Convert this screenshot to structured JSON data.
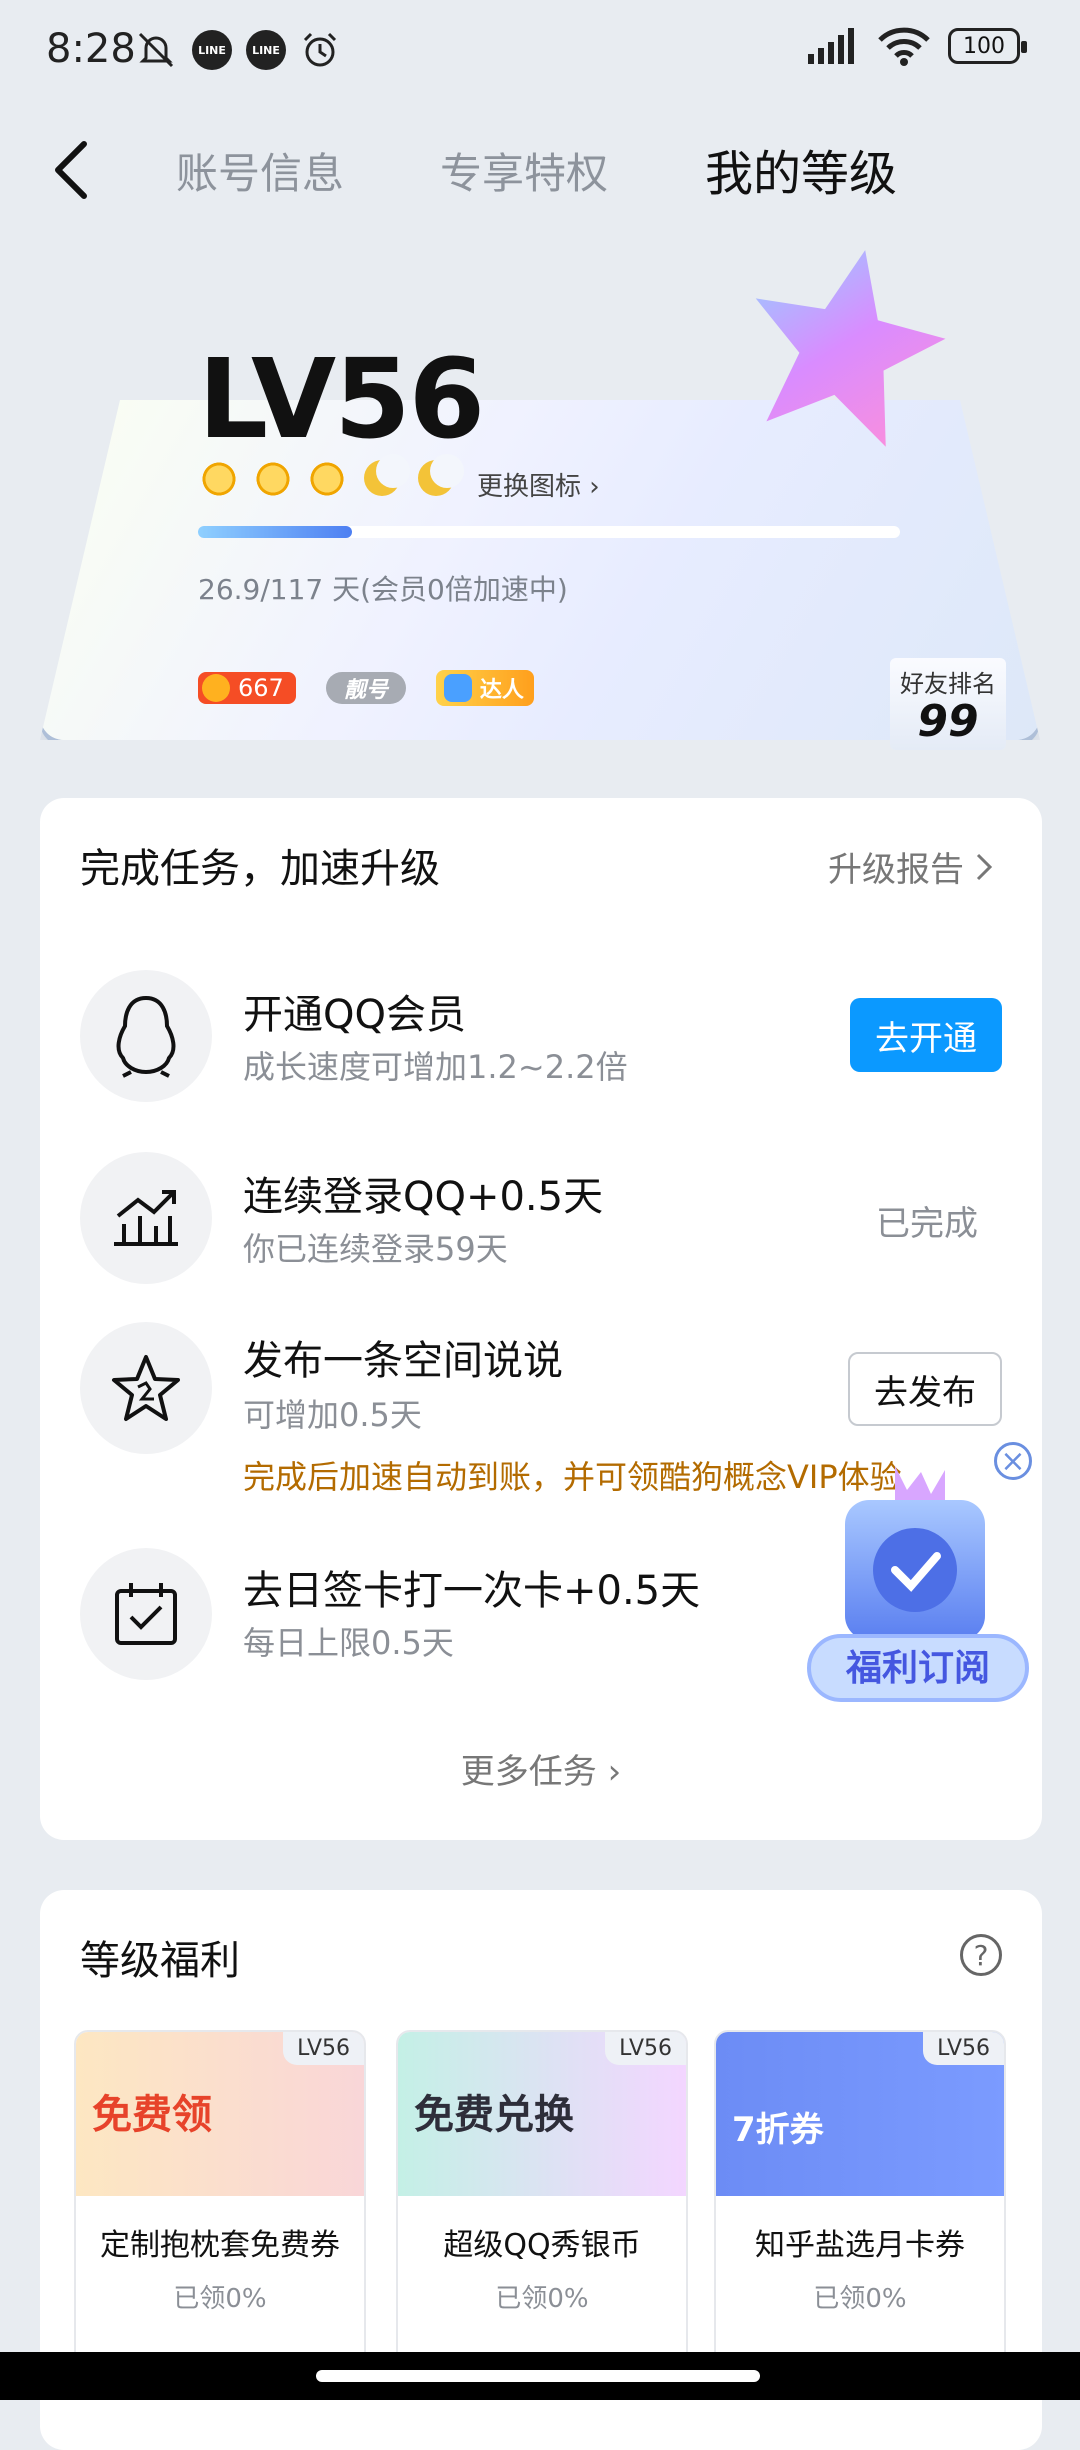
{
  "status_bar": {
    "time": "8:28",
    "line_icon_label": "LINE",
    "battery": "100"
  },
  "nav": {
    "tabs": [
      {
        "label": "账号信息"
      },
      {
        "label": "专享特权"
      },
      {
        "label": "我的等级"
      }
    ]
  },
  "level": {
    "title": "LV56",
    "change_icon_label": "更换图标",
    "progress_fraction": 0.22,
    "days_text": "26.9/117 天(会员0倍加速中)",
    "coin_count": "667",
    "pretty_badge": "靓号",
    "talent_badge": "达人",
    "rank_label": "好友排名",
    "rank_value": "99"
  },
  "tasks": {
    "title": "完成任务，加速升级",
    "report_link": "升级报告",
    "items": [
      {
        "title": "开通QQ会员",
        "subtitle": "成长速度可增加1.2~2.2倍",
        "action": "去开通"
      },
      {
        "title": "连续登录QQ+0.5天",
        "subtitle": "你已连续登录59天",
        "action": "已完成"
      },
      {
        "title": "发布一条空间说说",
        "subtitle": "可增加0.5天",
        "extra": "完成后加速自动到账，并可领酷狗概念VIP体验",
        "action": "去发布"
      },
      {
        "title": "去日签卡打一次卡+0.5天",
        "subtitle": "每日上限0.5天"
      }
    ],
    "more": "更多任务"
  },
  "promo": {
    "label": "福利订阅"
  },
  "benefits": {
    "title": "等级福利",
    "help": "?",
    "items": [
      {
        "tag": "LV56",
        "img_text": "免费领",
        "name": "定制抱枕套免费券",
        "claimed": "已领0%"
      },
      {
        "tag": "LV56",
        "img_text": "免费兑换",
        "name": "超级QQ秀银币",
        "claimed": "已领0%"
      },
      {
        "tag": "LV56",
        "img_text": "7折券",
        "name": "知乎盐选月卡券",
        "claimed": "已领0%"
      }
    ]
  },
  "colors": {
    "accent": "#0b99ff",
    "warning_text": "#b36b00",
    "page_bg": "#e8ecf1"
  }
}
